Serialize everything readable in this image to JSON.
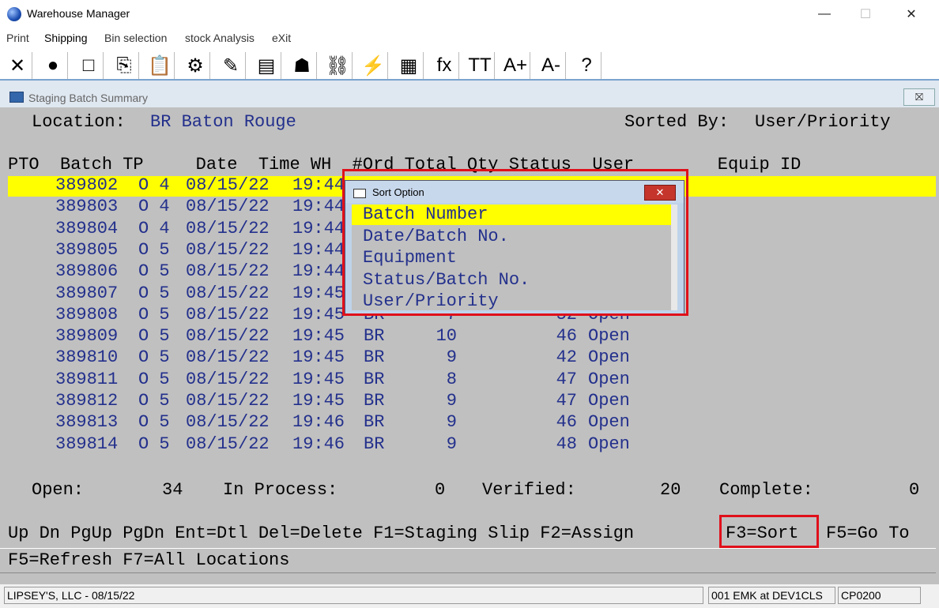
{
  "window": {
    "title": "Warehouse Manager",
    "minimize": "—",
    "maximize": "☐",
    "close": "✕"
  },
  "menu": [
    "Print",
    "Shipping",
    "Bin selection",
    "stock Analysis",
    "eXit"
  ],
  "toolbar": [
    {
      "icon": "exit-x-icon",
      "glyph": "✕"
    },
    {
      "icon": "globe-icon",
      "glyph": "●"
    },
    {
      "icon": "blank-page-icon",
      "glyph": "□"
    },
    {
      "icon": "copy-icon",
      "glyph": "⎘"
    },
    {
      "icon": "paste-icon",
      "glyph": "📋"
    },
    {
      "icon": "settings-gear-icon",
      "glyph": "⚙"
    },
    {
      "icon": "edit-icon",
      "glyph": "✎"
    },
    {
      "icon": "form-icon",
      "glyph": "▤"
    },
    {
      "icon": "users-icon",
      "glyph": "☗"
    },
    {
      "icon": "link-chain-icon",
      "glyph": "⛓"
    },
    {
      "icon": "lightning-icon",
      "glyph": "⚡"
    },
    {
      "icon": "calendar-lightning-icon",
      "glyph": "▦"
    },
    {
      "icon": "function-fx-icon",
      "glyph": "fx"
    },
    {
      "icon": "font-size-icon",
      "glyph": "TT"
    },
    {
      "icon": "font-increase-icon",
      "glyph": "A+"
    },
    {
      "icon": "font-decrease-icon",
      "glyph": "A-"
    },
    {
      "icon": "help-icon",
      "glyph": "?"
    }
  ],
  "child_window": {
    "title": "Staging Batch Summary",
    "close": "⛝"
  },
  "header": {
    "location_label": "Location:",
    "location_value": "BR Baton Rouge",
    "sorted_label": "Sorted By:",
    "sorted_value": "User/Priority"
  },
  "columns": "PTO  Batch TP     Date  Time WH  #Ord Total Qty Status  User        Equip ID",
  "rows": [
    {
      "batch": "389802",
      "tp": "O 4",
      "date": "08/15/22",
      "time": "19:44",
      "wh": "",
      "ord": "",
      "qty": "",
      "status": ""
    },
    {
      "batch": "389803",
      "tp": "O 4",
      "date": "08/15/22",
      "time": "19:44",
      "wh": "",
      "ord": "",
      "qty": "",
      "status": ""
    },
    {
      "batch": "389804",
      "tp": "O 4",
      "date": "08/15/22",
      "time": "19:44",
      "wh": "",
      "ord": "",
      "qty": "",
      "status": ""
    },
    {
      "batch": "389805",
      "tp": "O 5",
      "date": "08/15/22",
      "time": "19:44",
      "wh": "",
      "ord": "",
      "qty": "",
      "status": ""
    },
    {
      "batch": "389806",
      "tp": "O 5",
      "date": "08/15/22",
      "time": "19:44",
      "wh": "",
      "ord": "",
      "qty": "",
      "status": ""
    },
    {
      "batch": "389807",
      "tp": "O 5",
      "date": "08/15/22",
      "time": "19:45",
      "wh": "",
      "ord": "",
      "qty": "",
      "status": ""
    },
    {
      "batch": "389808",
      "tp": "O 5",
      "date": "08/15/22",
      "time": "19:45",
      "wh": "BR",
      "ord": "7",
      "qty": "52",
      "status": "Open"
    },
    {
      "batch": "389809",
      "tp": "O 5",
      "date": "08/15/22",
      "time": "19:45",
      "wh": "BR",
      "ord": "10",
      "qty": "46",
      "status": "Open"
    },
    {
      "batch": "389810",
      "tp": "O 5",
      "date": "08/15/22",
      "time": "19:45",
      "wh": "BR",
      "ord": "9",
      "qty": "42",
      "status": "Open"
    },
    {
      "batch": "389811",
      "tp": "O 5",
      "date": "08/15/22",
      "time": "19:45",
      "wh": "BR",
      "ord": "8",
      "qty": "47",
      "status": "Open"
    },
    {
      "batch": "389812",
      "tp": "O 5",
      "date": "08/15/22",
      "time": "19:45",
      "wh": "BR",
      "ord": "9",
      "qty": "47",
      "status": "Open"
    },
    {
      "batch": "389813",
      "tp": "O 5",
      "date": "08/15/22",
      "time": "19:46",
      "wh": "BR",
      "ord": "9",
      "qty": "46",
      "status": "Open"
    },
    {
      "batch": "389814",
      "tp": "O 5",
      "date": "08/15/22",
      "time": "19:46",
      "wh": "BR",
      "ord": "9",
      "qty": "48",
      "status": "Open"
    }
  ],
  "totals": {
    "open_label": "Open:",
    "open": "34",
    "inproc_label": "In Process:",
    "inproc": "0",
    "verified_label": "Verified:",
    "verified": "20",
    "complete_label": "Complete:",
    "complete": "0"
  },
  "fkeys_line1_a": "Up Dn PgUp PgDn Ent=Dtl Del=Delete F1=Staging Slip F2=Assign",
  "fkeys_sort": "F3=Sort",
  "fkeys_line1_b": "F5=Go To",
  "fkeys_line2": "F5=Refresh F7=All Locations",
  "dialog": {
    "title": "Sort Option",
    "close": "✕",
    "options": [
      "Batch Number",
      "Date/Batch No.",
      "Equipment",
      "Status/Batch No.",
      "User/Priority"
    ],
    "selected_index": 0
  },
  "status": {
    "company": "LIPSEY'S, LLC - 08/15/22",
    "session": "001 EMK at DEV1CLS",
    "program": "CP0200"
  }
}
